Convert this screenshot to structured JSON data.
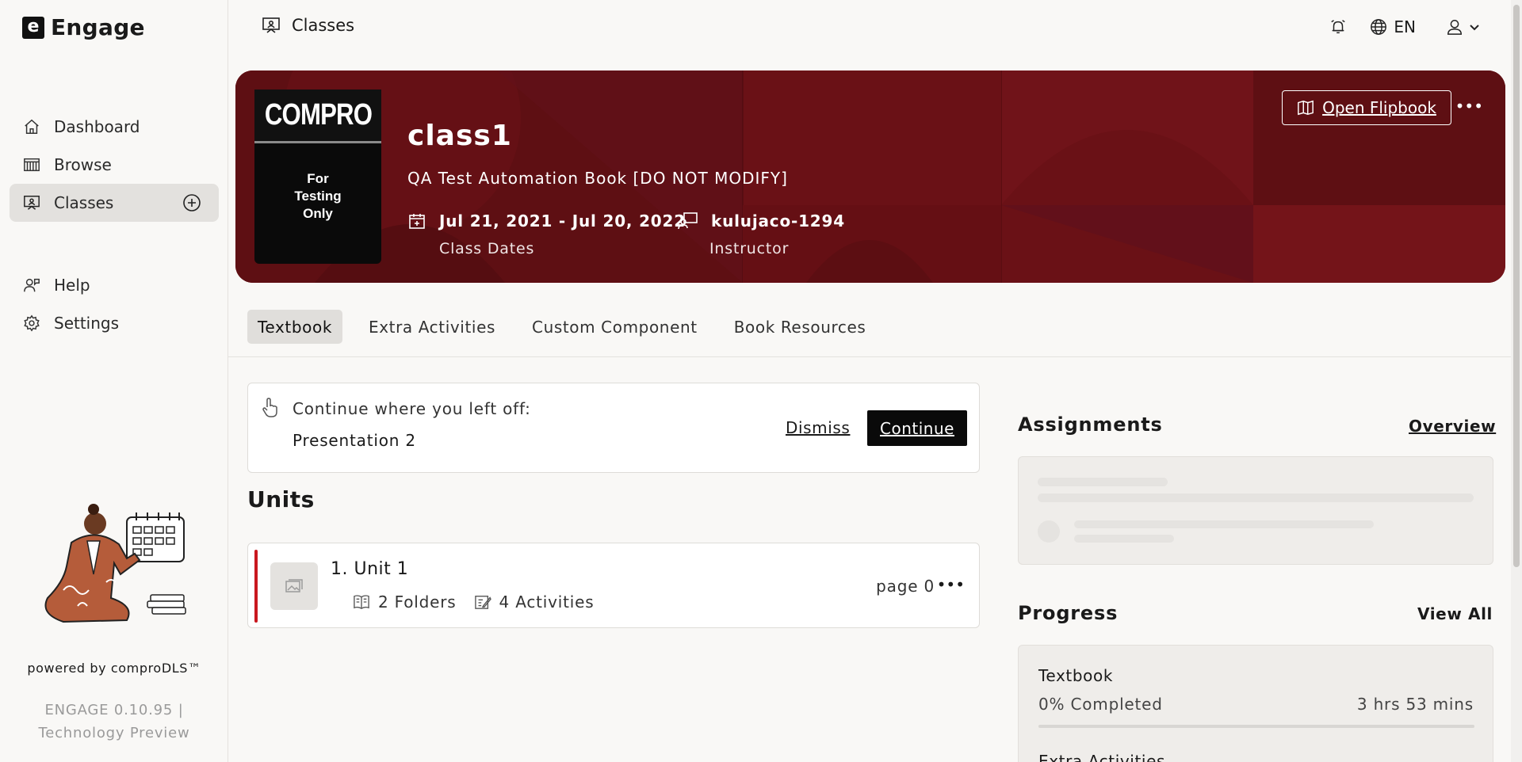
{
  "app": {
    "name": "Engage",
    "logo_letter": "e"
  },
  "sidebar": {
    "items": [
      {
        "label": "Dashboard",
        "icon": "home-icon"
      },
      {
        "label": "Browse",
        "icon": "library-icon"
      },
      {
        "label": "Classes",
        "icon": "presentation-icon",
        "active": true
      },
      {
        "label": "Help",
        "icon": "help-person-icon"
      },
      {
        "label": "Settings",
        "icon": "gear-icon"
      }
    ],
    "powered_by": "powered by comproDLS™",
    "version_line1": "ENGAGE 0.10.95 |",
    "version_line2": "Technology Preview"
  },
  "header": {
    "title": "Classes",
    "language": "EN"
  },
  "hero": {
    "class_name": "class1",
    "book_title": "QA Test Automation Book [DO NOT MODIFY]",
    "cover_title": "COMPRO",
    "cover_lines": [
      "For",
      "Testing",
      "Only"
    ],
    "dates": "Jul 21, 2021 -  Jul 20, 2022",
    "dates_label": "Class Dates",
    "instructor": "kulujaco-1294",
    "instructor_label": "Instructor",
    "flipbook_label": "Open Flipbook",
    "background_color": "#6a1116"
  },
  "tabs": [
    {
      "label": "Textbook",
      "active": true
    },
    {
      "label": "Extra Activities"
    },
    {
      "label": "Custom Component"
    },
    {
      "label": "Book Resources"
    }
  ],
  "continue_card": {
    "label": "Continue where you left off:",
    "item": "Presentation 2",
    "dismiss_label": "Dismiss",
    "continue_label": "Continue"
  },
  "units": {
    "title": "Units",
    "items": [
      {
        "name": "1. Unit 1",
        "folders": "2 Folders",
        "activities": "4 Activities",
        "page": "page 0"
      }
    ]
  },
  "assignments": {
    "title": "Assignments",
    "link": "Overview"
  },
  "progress": {
    "title": "Progress",
    "link": "View All",
    "items": [
      {
        "name": "Textbook",
        "percent_label": "0% Completed",
        "time": "3 hrs 53 mins",
        "percent": 0
      },
      {
        "name": "Extra Activities"
      }
    ]
  },
  "colors": {
    "accent": "#c9181f",
    "hero": "#6a1116",
    "primary_button": "#0a0a0a"
  }
}
